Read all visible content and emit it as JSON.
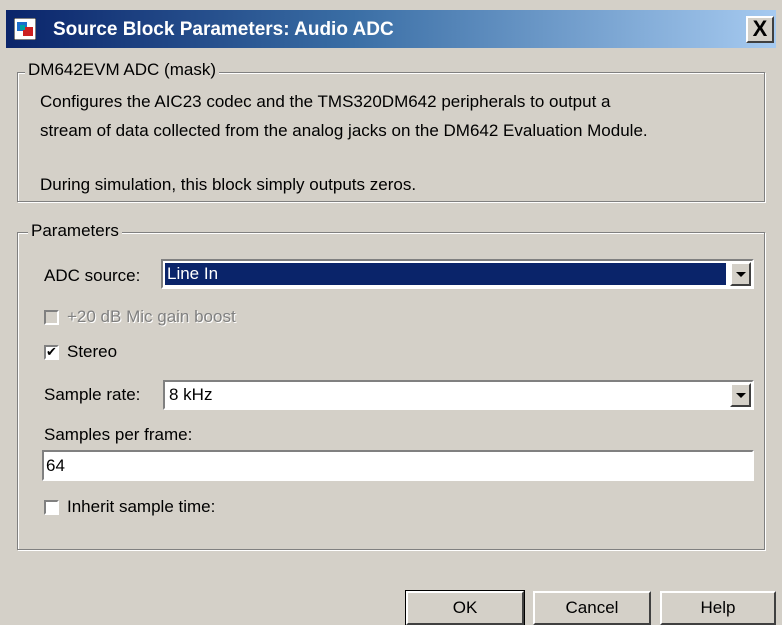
{
  "window": {
    "title": "Source Block Parameters: Audio ADC",
    "close_label": "X"
  },
  "mask_group": {
    "label": "DM642EVM ADC (mask)",
    "description_line1": "Configures the AIC23 codec and the TMS320DM642 peripherals to output a",
    "description_line2": "stream of data collected from the analog jacks on the DM642 Evaluation Module.",
    "description_line3": "During simulation, this block simply outputs zeros."
  },
  "parameters": {
    "label": "Parameters",
    "adc_source": {
      "label": "ADC source:",
      "value": "Line In"
    },
    "mic_boost": {
      "label": "+20 dB Mic gain boost",
      "checked": false,
      "enabled": false
    },
    "stereo": {
      "label": "Stereo",
      "checked": true,
      "check_glyph": "✔"
    },
    "sample_rate": {
      "label": "Sample rate:",
      "value": "8 kHz"
    },
    "samples_per_frame": {
      "label": "Samples per frame:",
      "value": "64"
    },
    "inherit_sample_time": {
      "label": "Inherit sample time:",
      "checked": false
    }
  },
  "buttons": {
    "ok": "OK",
    "cancel": "Cancel",
    "help": "Help"
  },
  "icons": {
    "app": "simulink-block-icon",
    "close": "close-icon",
    "dropdown": "chevron-down-icon"
  },
  "colors": {
    "title_active": "#0a246a",
    "selection": "#0a246a",
    "face": "#d4d0c8"
  }
}
